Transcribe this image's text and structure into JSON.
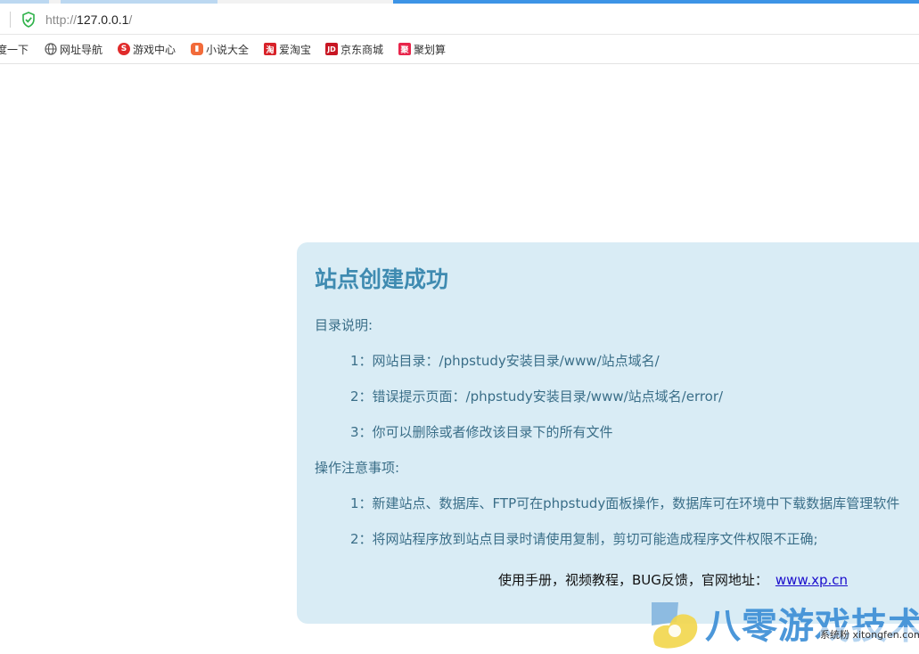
{
  "browser": {
    "url_scheme": "http://",
    "url_host": "127.0.0.1",
    "url_tail": "/",
    "bookmarks": [
      {
        "label": "度一下",
        "icon": "none",
        "color": ""
      },
      {
        "label": "网址导航",
        "icon": "globe-icon",
        "color": "#555555"
      },
      {
        "label": "游戏中心",
        "icon": "game-icon",
        "color": "#e02b2b"
      },
      {
        "label": "小说大全",
        "icon": "book-icon",
        "color": "#f26b3a"
      },
      {
        "label": "爱淘宝",
        "icon": "taobao-icon",
        "color": "#d8232a",
        "glyph": "淘"
      },
      {
        "label": "京东商城",
        "icon": "jd-icon",
        "color": "#c81623",
        "glyph": "JD"
      },
      {
        "label": "聚划算",
        "icon": "juhuasuan-icon",
        "color": "#e8254b",
        "glyph": "聚"
      }
    ]
  },
  "card": {
    "title": "站点创建成功",
    "dir_heading": "目录说明:",
    "dir_items": [
      "1：网站目录：/phpstudy安装目录/www/站点域名/",
      "2：错误提示页面：/phpstudy安装目录/www/站点域名/error/",
      "3：你可以删除或者修改该目录下的所有文件"
    ],
    "ops_heading": "操作注意事项:",
    "ops_items": [
      "1：新建站点、数据库、FTP可在phpstudy面板操作，数据库可在环境中下载数据库管理软件",
      "2：将网站程序放到站点目录时请使用复制，剪切可能造成程序文件权限不正确;"
    ],
    "footer_text": "使用手册，视频教程，BUG反馈，官网地址：",
    "footer_link": "www.xp.cn"
  },
  "watermark": {
    "main": "八零游戏技术",
    "sub": "系统粉 xitongfen.com"
  },
  "colors": {
    "card_bg": "#d9ecf5",
    "title": "#3f8bb1",
    "text": "#3a6e88",
    "link": "#1a0dcc"
  }
}
